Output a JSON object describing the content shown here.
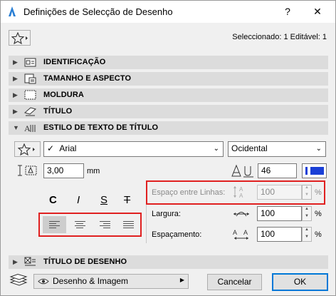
{
  "window": {
    "title": "Definições de Selecção de Desenho",
    "help_label": "?",
    "close_label": "✕"
  },
  "header": {
    "selection_status": "Seleccionado: 1 Editável: 1"
  },
  "sections": [
    {
      "label": "IDENTIFICAÇÃO",
      "expanded": false
    },
    {
      "label": "TAMANHO E ASPECTO",
      "expanded": false
    },
    {
      "label": "MOLDURA",
      "expanded": false
    },
    {
      "label": "TÍTULO",
      "expanded": false
    },
    {
      "label": "ESTILO DE TEXTO DE TÍTULO",
      "expanded": true
    },
    {
      "label": "TÍTULO DE DESENHO",
      "expanded": false
    }
  ],
  "text_style": {
    "font_name": "Arial",
    "font_check": "✓",
    "script": "Ocidental",
    "font_size": "3,00",
    "font_size_unit": "mm",
    "pen_number": "46",
    "pen_color": "#1a3fd6",
    "style_buttons": [
      "C",
      "I",
      "S",
      "T"
    ],
    "line_spacing_label": "Espaço entre Linhas:",
    "line_spacing_value": "100",
    "width_label": "Largura:",
    "width_value": "100",
    "spacing_label": "Espaçamento:",
    "spacing_value": "100",
    "percent": "%"
  },
  "footer": {
    "view_option": "Desenho & Imagem",
    "cancel_label": "Cancelar",
    "ok_label": "OK"
  },
  "colors": {
    "accent": "#0078d7",
    "highlight": "#e02020"
  }
}
